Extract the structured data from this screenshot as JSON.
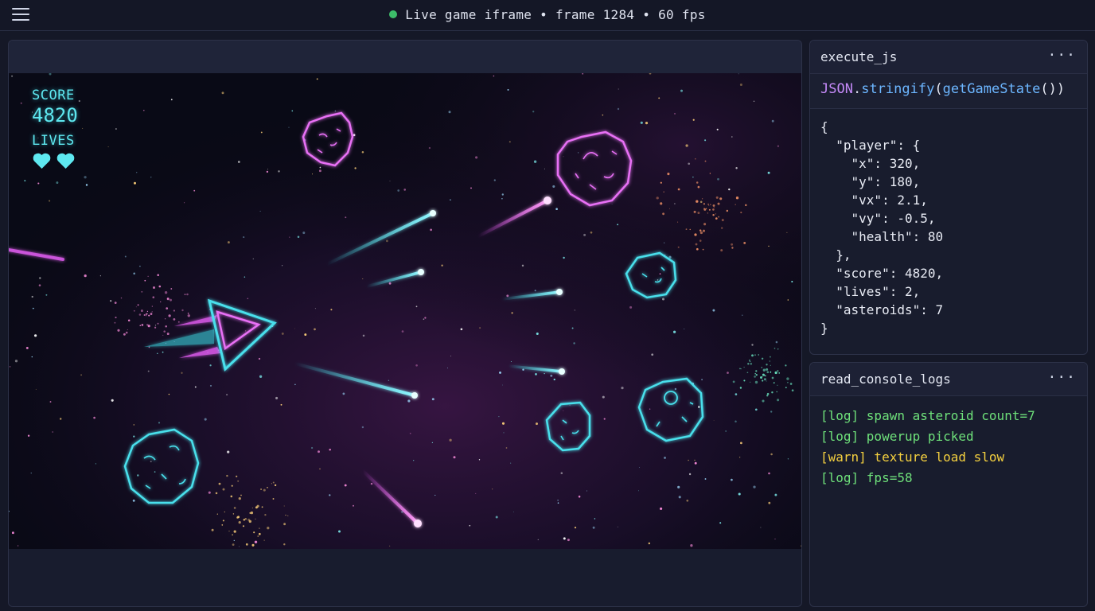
{
  "topbar": {
    "title": "Live game iframe • frame 1284 • 60 fps",
    "status_color": "#3dbd6a"
  },
  "game": {
    "hud": {
      "score_label": "SCORE",
      "score_value": "4820",
      "lives_label": "LIVES",
      "lives_count": 2
    },
    "colors": {
      "accent_cyan": "#5ee8f0",
      "accent_magenta": "#e05cf0",
      "background": "#0a0b18"
    }
  },
  "execute_js": {
    "title": "execute_js",
    "more_icon": "more-horizontal-icon",
    "code": {
      "object": "JSON",
      "dot": ".",
      "method": "stringify",
      "open": "(",
      "call": "getGameState",
      "close": "())"
    },
    "output": "{\n  \"player\": {\n    \"x\": 320,\n    \"y\": 180,\n    \"vx\": 2.1,\n    \"vy\": -0.5,\n    \"health\": 80\n  },\n  \"score\": 4820,\n  \"lives\": 2,\n  \"asteroids\": 7\n}"
  },
  "console": {
    "title": "read_console_logs",
    "more_icon": "more-horizontal-icon",
    "logs": [
      {
        "level": "log",
        "text": "[log] spawn asteroid count=7"
      },
      {
        "level": "log",
        "text": "[log] powerup picked"
      },
      {
        "level": "warn",
        "text": "[warn] texture load slow"
      },
      {
        "level": "log",
        "text": "[log] fps=58"
      }
    ]
  }
}
